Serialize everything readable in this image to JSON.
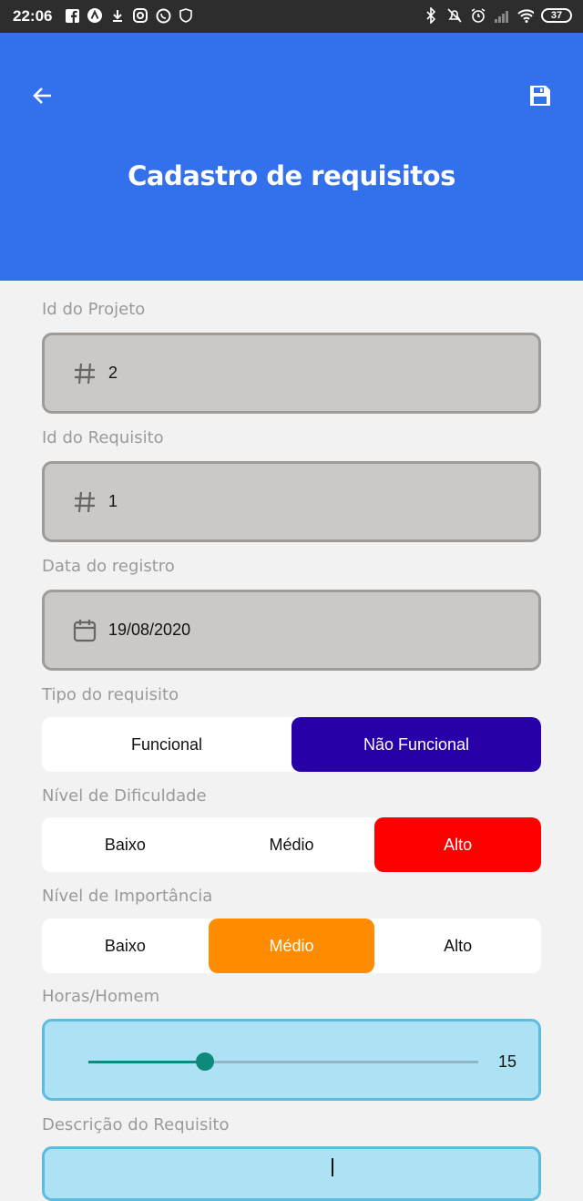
{
  "status_bar": {
    "time": "22:06",
    "battery": "37"
  },
  "header": {
    "title": "Cadastro de requisitos"
  },
  "fields": {
    "project_id": {
      "label": "Id do Projeto",
      "value": "2"
    },
    "requirement_id": {
      "label": "Id do Requisito",
      "value": "1"
    },
    "date": {
      "label": "Data do registro",
      "value": "19/08/2020"
    }
  },
  "tipo": {
    "label": "Tipo do requisito",
    "options": [
      "Funcional",
      "Não Funcional"
    ],
    "selected": 1,
    "selected_color": "#2700a8"
  },
  "dificuldade": {
    "label": "Nível de Dificuldade",
    "options": [
      "Baixo",
      "Médio",
      "Alto"
    ],
    "selected": 2,
    "selected_color": "#ff0000"
  },
  "importancia": {
    "label": "Nível de Importância",
    "options": [
      "Baixo",
      "Médio",
      "Alto"
    ],
    "selected": 1,
    "selected_color": "#ff8c00"
  },
  "horas": {
    "label": "Horas/Homem",
    "value": "15",
    "fraction": 0.3
  },
  "descricao": {
    "label": "Descrição do Requisito"
  },
  "colors": {
    "header": "#3270ec",
    "field_bg": "#cbc9c7",
    "slider_bg": "#ade2f5",
    "slider_accent": "#0e8a7c"
  }
}
